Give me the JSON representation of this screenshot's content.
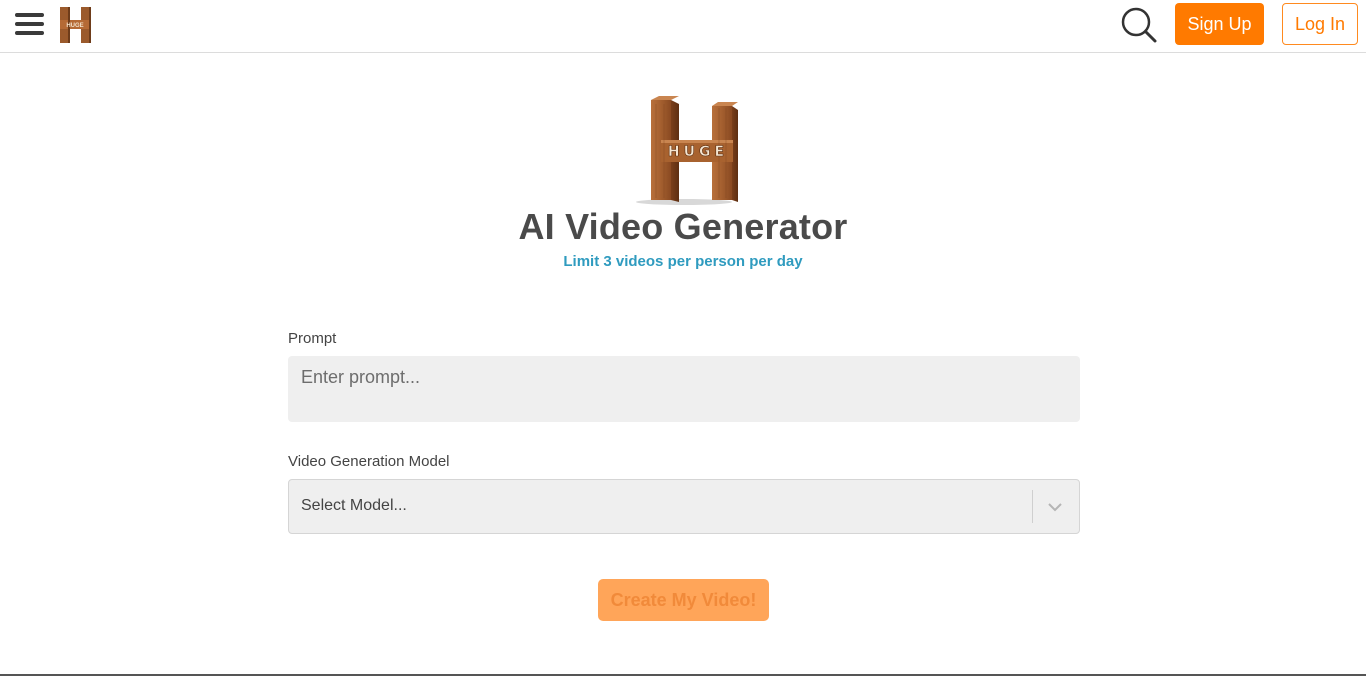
{
  "header": {
    "menu_icon": "hamburger-icon",
    "logo_text": "HUGE",
    "search_icon": "search-icon",
    "signup_label": "Sign Up",
    "login_label": "Log In"
  },
  "hero": {
    "logo_text": "HUGE",
    "title": "AI Video Generator",
    "subtitle": "Limit 3 videos per person per day"
  },
  "form": {
    "prompt_label": "Prompt",
    "prompt_placeholder": "Enter prompt...",
    "prompt_value": "",
    "model_label": "Video Generation Model",
    "model_placeholder": "Select Model...",
    "model_chevron_icon": "chevron-down-icon",
    "submit_label": "Create My Video!"
  },
  "colors": {
    "accent": "#ff7a00",
    "subtitle": "#2f9bbf",
    "submit_disabled_bg": "#ffa559",
    "field_bg": "#efefef"
  }
}
